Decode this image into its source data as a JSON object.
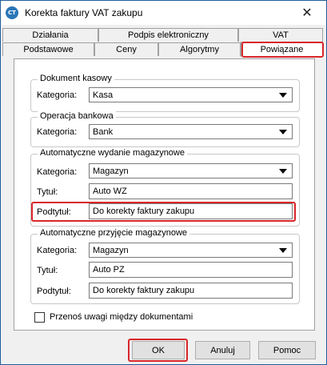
{
  "window": {
    "title": "Korekta faktury VAT zakupu",
    "icon_text": "CT",
    "close_symbol": "✕"
  },
  "tabs": {
    "row1": [
      "Działania",
      "Podpis elektroniczny",
      "VAT"
    ],
    "row2": [
      "Podstawowe",
      "Ceny",
      "Algorytmy",
      "Powiązane"
    ],
    "active": "Powiązane"
  },
  "groups": {
    "dokument_kasowy": {
      "title": "Dokument kasowy",
      "kategoria_label": "Kategoria:",
      "kategoria_value": "Kasa"
    },
    "operacja_bankowa": {
      "title": "Operacja bankowa",
      "kategoria_label": "Kategoria:",
      "kategoria_value": "Bank"
    },
    "wydanie": {
      "title": "Automatyczne wydanie magazynowe",
      "kategoria_label": "Kategoria:",
      "kategoria_value": "Magazyn",
      "tytul_label": "Tytuł:",
      "tytul_value": "Auto WZ",
      "podtytul_label": "Podtytuł:",
      "podtytul_value": "Do korekty faktury zakupu"
    },
    "przyjecie": {
      "title": "Automatyczne przyjęcie magazynowe",
      "kategoria_label": "Kategoria:",
      "kategoria_value": "Magazyn",
      "tytul_label": "Tytuł:",
      "tytul_value": "Auto PZ",
      "podtytul_label": "Podtytuł:",
      "podtytul_value": "Do korekty faktury zakupu"
    }
  },
  "checkbox": {
    "label": "Przenoś uwagi między dokumentami",
    "checked": false
  },
  "buttons": {
    "ok": "OK",
    "cancel": "Anuluj",
    "help": "Pomoc"
  },
  "highlight_color": "#d9262a"
}
